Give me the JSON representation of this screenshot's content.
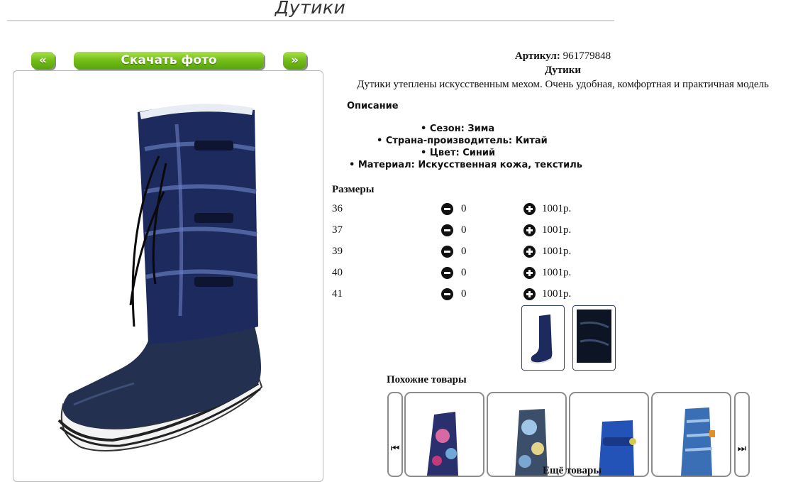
{
  "page": {
    "title": "Дутики"
  },
  "gallery": {
    "prev_label": "«",
    "download_label": "Скачать фото",
    "next_label": "»"
  },
  "product": {
    "article_label": "Артикул:",
    "article_value": "961779848",
    "name": "Дутики",
    "short_description": "Дутики утеплены искусственным мехом. Очень удобная, комфортная и практичная модель",
    "description_heading": "Описание",
    "attributes": [
      "• Сезон: Зима",
      "• Страна-производитель: Китай",
      "• Цвет: Синий",
      "• Материал: Искусственная кожа, текстиль"
    ]
  },
  "sizes": {
    "heading": "Размеры",
    "rows": [
      {
        "size": "36",
        "qty": "0",
        "price": "1001р."
      },
      {
        "size": "37",
        "qty": "0",
        "price": "1001р."
      },
      {
        "size": "39",
        "qty": "0",
        "price": "1001р."
      },
      {
        "size": "40",
        "qty": "0",
        "price": "1001р."
      },
      {
        "size": "41",
        "qty": "0",
        "price": "1001р."
      }
    ]
  },
  "similar": {
    "heading": "Похожие товары",
    "prev_icon": "⏮",
    "next_icon": "⏭",
    "more_label": "Ещё товары"
  },
  "colors": {
    "accent_green": "#74bd18",
    "boot_navy": "#1c2a5e"
  }
}
